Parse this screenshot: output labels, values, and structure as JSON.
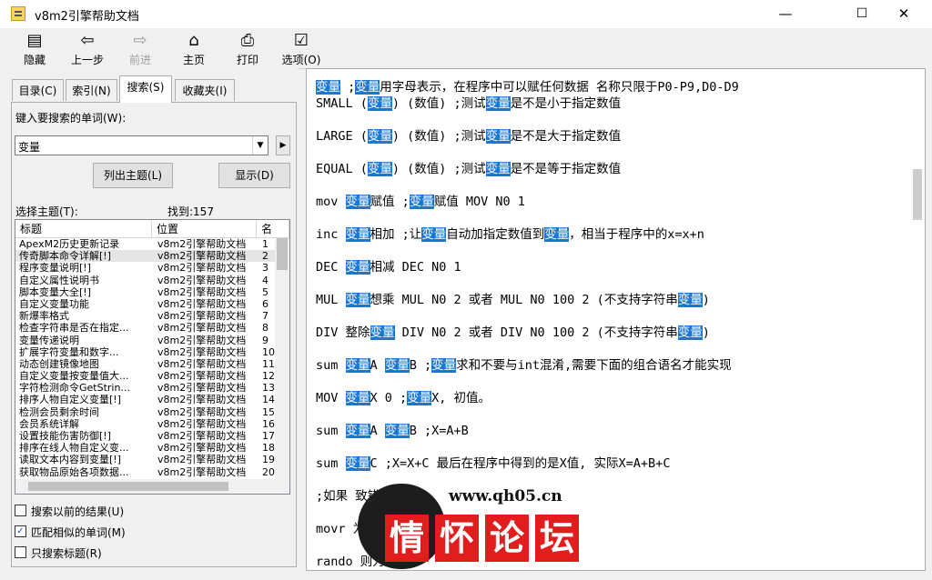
{
  "window": {
    "title": "v8m2引擎帮助文档",
    "minimize": "—",
    "maximize": "☐",
    "close": "✕"
  },
  "toolbar": {
    "hide": "隐藏",
    "back": "上一步",
    "forward": "前进",
    "home": "主页",
    "print": "打印",
    "options": "选项(O)"
  },
  "tabs": [
    "目录(C)",
    "索引(N)",
    "搜索(S)",
    "收藏夹(I)"
  ],
  "search": {
    "prompt": "键入要搜索的单词(W):",
    "keyword": "变量",
    "list_topics": "列出主题(L)",
    "display": "显示(D)",
    "select_topic": "选择主题(T):",
    "found": "找到:157",
    "columns": {
      "title": "标题",
      "location": "位置",
      "rank": "名"
    },
    "rows": [
      [
        "ApexM2历史更新记录",
        "v8m2引擎帮助文档",
        "1"
      ],
      [
        "传奇脚本命令详解[!]",
        "v8m2引擎帮助文档",
        "2"
      ],
      [
        "程序变量说明[!]",
        "v8m2引擎帮助文档",
        "3"
      ],
      [
        "自定义属性说明书",
        "v8m2引擎帮助文档",
        "4"
      ],
      [
        "脚本变量大全[!]",
        "v8m2引擎帮助文档",
        "5"
      ],
      [
        "自定义变量功能",
        "v8m2引擎帮助文档",
        "6"
      ],
      [
        "新爆率格式",
        "v8m2引擎帮助文档",
        "7"
      ],
      [
        "检查字符串是否在指定...",
        "v8m2引擎帮助文档",
        "8"
      ],
      [
        "变量传递说明",
        "v8m2引擎帮助文档",
        "9"
      ],
      [
        "扩展字符变量和数字...",
        "v8m2引擎帮助文档",
        "10"
      ],
      [
        "动态创建镜像地图",
        "v8m2引擎帮助文档",
        "11"
      ],
      [
        "自定义变量按变量值大...",
        "v8m2引擎帮助文档",
        "12"
      ],
      [
        "字符检测命令GetStrin...",
        "v8m2引擎帮助文档",
        "13"
      ],
      [
        "排序人物自定义变量[!]",
        "v8m2引擎帮助文档",
        "14"
      ],
      [
        "检测会员剩余时间",
        "v8m2引擎帮助文档",
        "15"
      ],
      [
        "会员系统详解",
        "v8m2引擎帮助文档",
        "16"
      ],
      [
        "设置技能伤害防御[!]",
        "v8m2引擎帮助文档",
        "17"
      ],
      [
        "排序在线人物自定义变...",
        "v8m2引擎帮助文档",
        "18"
      ],
      [
        "读取文本内容到变量[!]",
        "v8m2引擎帮助文档",
        "19"
      ],
      [
        "获取物品原始各项数据...",
        "v8m2引擎帮助文档",
        "20"
      ]
    ],
    "options": {
      "previous_results": "搜索以前的结果(U)",
      "match_similar": "匹配相似的单词(M)",
      "titles_only": "只搜索标题(R)"
    }
  },
  "content": {
    "lines": [
      [
        [
          "变量",
          true
        ],
        [
          " ;",
          false
        ],
        [
          "变量",
          true
        ],
        [
          "用字母表示，在程序中可以赋任何数据 名称只限于P0-P9,D0-D9",
          false
        ]
      ],
      [
        [
          "SMALL (",
          false
        ],
        [
          "变量",
          true
        ],
        [
          ") (数值) ;测试",
          false
        ],
        [
          "变量",
          true
        ],
        [
          "是不是小于指定数值",
          false
        ]
      ],
      [
        [
          "LARGE (",
          false
        ],
        [
          "变量",
          true
        ],
        [
          ") (数值) ;测试",
          false
        ],
        [
          "变量",
          true
        ],
        [
          "是不是大于指定数值",
          false
        ]
      ],
      [
        [
          "EQUAL (",
          false
        ],
        [
          "变量",
          true
        ],
        [
          ") (数值) ;测试",
          false
        ],
        [
          "变量",
          true
        ],
        [
          "是不是等于指定数值",
          false
        ]
      ],
      [
        [
          "mov ",
          false
        ],
        [
          "变量",
          true
        ],
        [
          "赋值 ;",
          false
        ],
        [
          "变量",
          true
        ],
        [
          "赋值 MOV N0 1",
          false
        ]
      ],
      [
        [
          "inc ",
          false
        ],
        [
          "变量",
          true
        ],
        [
          "相加 ;让",
          false
        ],
        [
          "变量",
          true
        ],
        [
          "自动加指定数值到",
          false
        ],
        [
          "变量",
          true
        ],
        [
          "，相当于程序中的x=x+n",
          false
        ]
      ],
      [
        [
          "DEC ",
          false
        ],
        [
          "变量",
          true
        ],
        [
          "相减 DEC N0 1",
          false
        ]
      ],
      [
        [
          "MUL ",
          false
        ],
        [
          "变量",
          true
        ],
        [
          "想乘 MUL N0 2 或者 MUL N0 100 2 (不支持字符串",
          false
        ],
        [
          "变量",
          true
        ],
        [
          ")",
          false
        ]
      ],
      [
        [
          "DIV 整除",
          false
        ],
        [
          "变量",
          true
        ],
        [
          " DIV N0 2 或者 DIV N0 100 2 (不支持字符串",
          false
        ],
        [
          "变量",
          true
        ],
        [
          ")",
          false
        ]
      ],
      [
        [
          "sum ",
          false
        ],
        [
          "变量",
          true
        ],
        [
          "A ",
          false
        ],
        [
          "变量",
          true
        ],
        [
          "B ;",
          false
        ],
        [
          "变量",
          true
        ],
        [
          "求和不要与int混淆,需要下面的组合语名才能实现",
          false
        ]
      ],
      [
        [
          "MOV ",
          false
        ],
        [
          "变量",
          true
        ],
        [
          "X 0 ;",
          false
        ],
        [
          "变量",
          true
        ],
        [
          "X, 初值。",
          false
        ]
      ],
      [
        [
          "sum ",
          false
        ],
        [
          "变量",
          true
        ],
        [
          "A ",
          false
        ],
        [
          "变量",
          true
        ],
        [
          "B ;X=A+B",
          false
        ]
      ],
      [
        [
          "sum ",
          false
        ],
        [
          "变量",
          true
        ],
        [
          "C ;X=X+C 最后在程序中得到的是X值, 实际X=A+B+C",
          false
        ]
      ],
      [
        [
          ";如果                              致错误",
          false
        ]
      ],
      [
        [
          "movr                              为 “0 到 数值”",
          false
        ]
      ],
      [
        [
          "rando                             则为0",
          false
        ]
      ]
    ]
  },
  "watermark": {
    "url": "www.qh05.cn",
    "text": [
      "情",
      "怀",
      "论",
      "坛"
    ]
  }
}
